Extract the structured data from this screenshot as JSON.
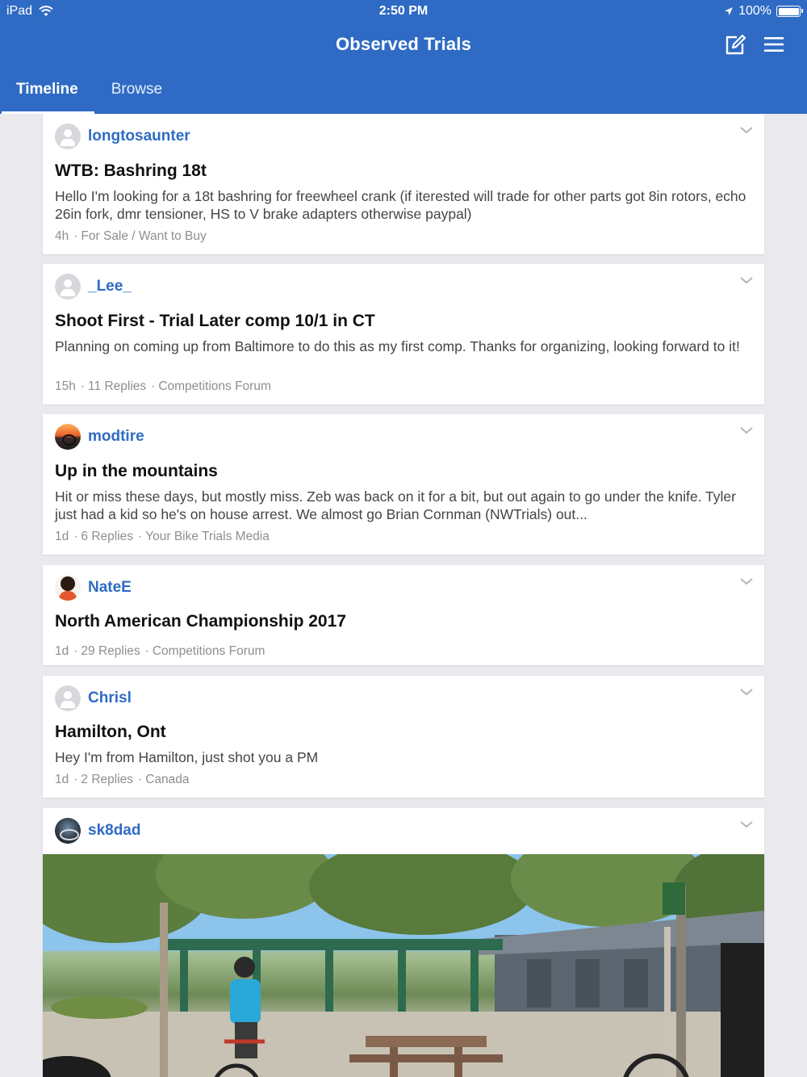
{
  "status_bar": {
    "device": "iPad",
    "time": "2:50 PM",
    "battery": "100%"
  },
  "header": {
    "title": "Observed Trials",
    "compose_icon": "compose-icon",
    "menu_icon": "hamburger-menu-icon",
    "color": "#2f6bc4"
  },
  "tabs": [
    {
      "label": "Timeline",
      "active": true
    },
    {
      "label": "Browse",
      "active": false
    }
  ],
  "posts": [
    {
      "username": "longtosaunter",
      "avatar": "default-avatar",
      "title": "WTB: Bashring 18t",
      "body": "Hello I'm looking for a 18t bashring for freewheel crank (if iterested will trade for other parts got 8in rotors, echo 26in fork, dmr tensioner, HS to V brake adapters otherwise paypal)",
      "time": "4h",
      "replies": "",
      "forum": "For Sale / Want to Buy"
    },
    {
      "username": "_Lee_",
      "avatar": "default-avatar",
      "title": "Shoot First - Trial Later comp 10/1 in CT",
      "body": "Planning on coming up from Baltimore to do this as my first comp. Thanks for organizing, looking forward to it!",
      "time": "15h",
      "replies": "11 Replies",
      "forum": "Competitions Forum"
    },
    {
      "username": "modtire",
      "avatar": "sunset-avatar",
      "title": "Up in the mountains",
      "body": "Hit or miss these days, but mostly miss. Zeb was back on it for a bit, but out again to go under the knife. Tyler just had a kid so he's on house arrest. We almost go Brian Cornman (NWTrials) out...",
      "time": "1d",
      "replies": "6 Replies",
      "forum": "Your Bike Trials Media"
    },
    {
      "username": "NateE",
      "avatar": "person-avatar",
      "title": "North American Championship 2017",
      "body": "",
      "time": "1d",
      "replies": "29 Replies",
      "forum": "Competitions Forum"
    },
    {
      "username": "Chrisl",
      "avatar": "default-avatar",
      "title": "Hamilton, Ont",
      "body": "Hey I'm from Hamilton, just shot you a PM",
      "time": "1d",
      "replies": "2 Replies",
      "forum": "Canada"
    },
    {
      "username": "sk8dad",
      "avatar": "bike-avatar",
      "photo": "park-photo"
    }
  ]
}
